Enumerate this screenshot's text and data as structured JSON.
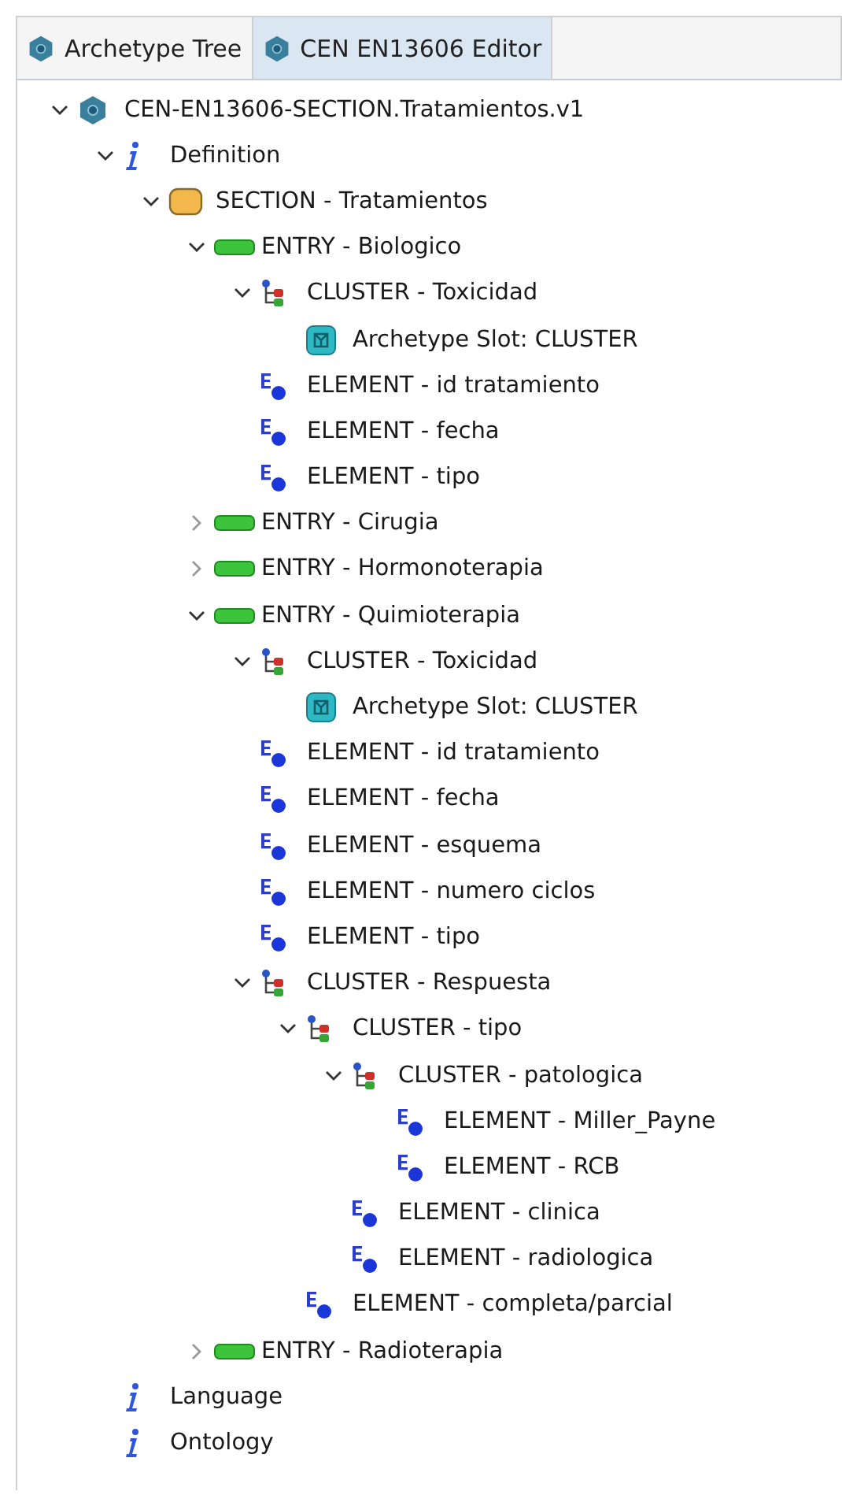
{
  "tabs": [
    {
      "label": "Archetype Tree",
      "selected": false
    },
    {
      "label": "CEN EN13606 Editor",
      "selected": true
    }
  ],
  "tree": [
    {
      "kind": "archetype",
      "label": "CEN-EN13606-SECTION.Tratamientos.v1",
      "expanded": true,
      "children": [
        {
          "kind": "info",
          "label": "Definition",
          "expanded": true,
          "children": [
            {
              "kind": "section",
              "label": "SECTION - Tratamientos",
              "expanded": true,
              "children": [
                {
                  "kind": "entry",
                  "label": "ENTRY - Biologico",
                  "expanded": true,
                  "children": [
                    {
                      "kind": "cluster",
                      "label": "CLUSTER - Toxicidad",
                      "expanded": true,
                      "children": [
                        {
                          "kind": "slot",
                          "label": "Archetype Slot: CLUSTER"
                        }
                      ]
                    },
                    {
                      "kind": "element",
                      "label": "ELEMENT - id tratamiento"
                    },
                    {
                      "kind": "element",
                      "label": "ELEMENT - fecha"
                    },
                    {
                      "kind": "element",
                      "label": "ELEMENT - tipo"
                    }
                  ]
                },
                {
                  "kind": "entry",
                  "label": "ENTRY - Cirugia",
                  "expanded": false
                },
                {
                  "kind": "entry",
                  "label": "ENTRY - Hormonoterapia",
                  "expanded": false
                },
                {
                  "kind": "entry",
                  "label": "ENTRY - Quimioterapia",
                  "expanded": true,
                  "children": [
                    {
                      "kind": "cluster",
                      "label": "CLUSTER - Toxicidad",
                      "expanded": true,
                      "children": [
                        {
                          "kind": "slot",
                          "label": "Archetype Slot: CLUSTER"
                        }
                      ]
                    },
                    {
                      "kind": "element",
                      "label": "ELEMENT - id tratamiento"
                    },
                    {
                      "kind": "element",
                      "label": "ELEMENT - fecha"
                    },
                    {
                      "kind": "element",
                      "label": "ELEMENT - esquema"
                    },
                    {
                      "kind": "element",
                      "label": "ELEMENT - numero ciclos"
                    },
                    {
                      "kind": "element",
                      "label": "ELEMENT - tipo"
                    },
                    {
                      "kind": "cluster",
                      "label": "CLUSTER - Respuesta",
                      "expanded": true,
                      "children": [
                        {
                          "kind": "cluster",
                          "label": "CLUSTER - tipo",
                          "expanded": true,
                          "children": [
                            {
                              "kind": "cluster",
                              "label": "CLUSTER - patologica",
                              "expanded": true,
                              "children": [
                                {
                                  "kind": "element",
                                  "label": "ELEMENT - Miller_Payne"
                                },
                                {
                                  "kind": "element",
                                  "label": "ELEMENT - RCB"
                                }
                              ]
                            },
                            {
                              "kind": "element",
                              "label": "ELEMENT - clinica"
                            },
                            {
                              "kind": "element",
                              "label": "ELEMENT - radiologica"
                            }
                          ]
                        },
                        {
                          "kind": "element",
                          "label": "ELEMENT - completa/parcial"
                        }
                      ]
                    }
                  ]
                },
                {
                  "kind": "entry",
                  "label": "ENTRY - Radioterapia",
                  "expanded": false
                }
              ]
            }
          ]
        },
        {
          "kind": "info",
          "label": "Language"
        },
        {
          "kind": "info",
          "label": "Ontology"
        }
      ]
    }
  ]
}
